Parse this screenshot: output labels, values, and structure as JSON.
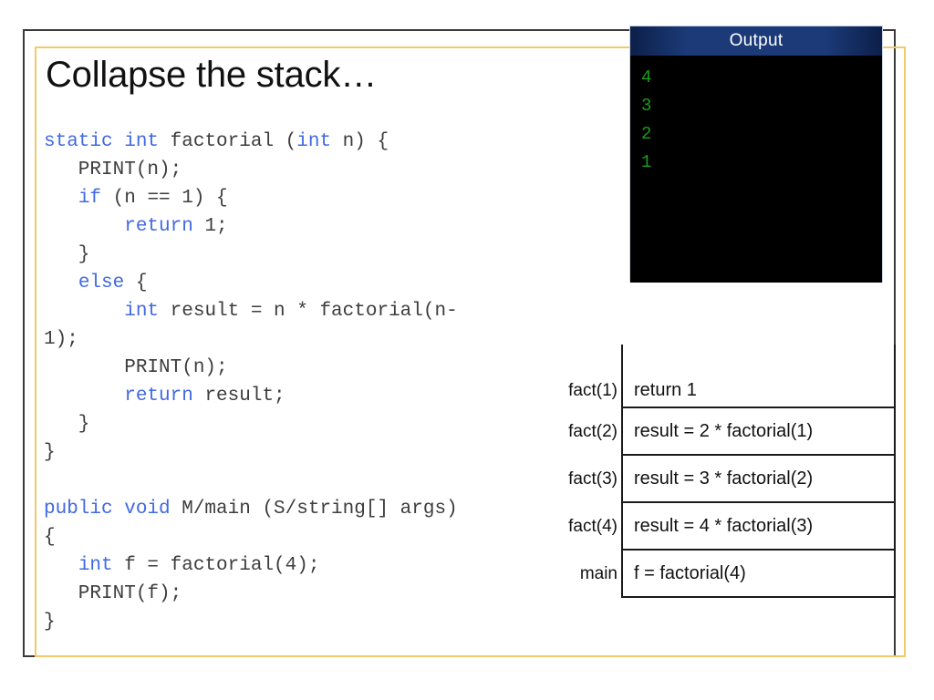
{
  "slide": {
    "title": "Collapse the stack…"
  },
  "code": {
    "lines": [
      [
        {
          "t": "static int",
          "c": "kw"
        },
        {
          "t": " factorial (",
          "c": "pl"
        },
        {
          "t": "int",
          "c": "kw"
        },
        {
          "t": " n) {",
          "c": "pl"
        }
      ],
      [
        {
          "t": "   PRINT(n);",
          "c": "pl"
        }
      ],
      [
        {
          "t": "   ",
          "c": "pl"
        },
        {
          "t": "if",
          "c": "kw"
        },
        {
          "t": " (n == 1) {",
          "c": "pl"
        }
      ],
      [
        {
          "t": "       ",
          "c": "pl"
        },
        {
          "t": "return",
          "c": "kw"
        },
        {
          "t": " 1;",
          "c": "pl"
        }
      ],
      [
        {
          "t": "   }",
          "c": "pl"
        }
      ],
      [
        {
          "t": "   ",
          "c": "pl"
        },
        {
          "t": "else",
          "c": "kw"
        },
        {
          "t": " {",
          "c": "pl"
        }
      ],
      [
        {
          "t": "       ",
          "c": "pl"
        },
        {
          "t": "int",
          "c": "kw"
        },
        {
          "t": " result = n * factorial(n-",
          "c": "pl"
        }
      ],
      [
        {
          "t": "1);",
          "c": "pl"
        }
      ],
      [
        {
          "t": "       PRINT(n);",
          "c": "pl"
        }
      ],
      [
        {
          "t": "       ",
          "c": "pl"
        },
        {
          "t": "return",
          "c": "kw"
        },
        {
          "t": " result;",
          "c": "pl"
        }
      ],
      [
        {
          "t": "   }",
          "c": "pl"
        }
      ],
      [
        {
          "t": "}",
          "c": "pl"
        }
      ],
      [
        {
          "t": "",
          "c": "pl"
        }
      ],
      [
        {
          "t": "public void",
          "c": "kw"
        },
        {
          "t": " M/main (S/string[] args)",
          "c": "pl"
        }
      ],
      [
        {
          "t": "{",
          "c": "pl"
        }
      ],
      [
        {
          "t": "   ",
          "c": "pl"
        },
        {
          "t": "int",
          "c": "kw"
        },
        {
          "t": " f = factorial(4);",
          "c": "pl"
        }
      ],
      [
        {
          "t": "   PRINT(f);",
          "c": "pl"
        }
      ],
      [
        {
          "t": "}",
          "c": "pl"
        }
      ]
    ]
  },
  "output": {
    "title": "Output",
    "lines": [
      "4",
      "3",
      "2",
      "1"
    ],
    "text_color": "#18a018",
    "header_color": "#1b3a77",
    "background_color": "#000000"
  },
  "call_stack": {
    "frames": [
      {
        "label": "fact(1)",
        "body": "return 1"
      },
      {
        "label": "fact(2)",
        "body": "result = 2 * factorial(1)"
      },
      {
        "label": "fact(3)",
        "body": "result = 3 * factorial(2)"
      },
      {
        "label": "fact(4)",
        "body": "result = 4 * factorial(3)"
      },
      {
        "label": "main",
        "body": "f = factorial(4)"
      }
    ]
  },
  "theme": {
    "frame_outer": "#3a3a3a",
    "frame_inner": "#f2c96b",
    "keyword_blue": "#4169e1",
    "code_gray": "#3d3d3d"
  }
}
